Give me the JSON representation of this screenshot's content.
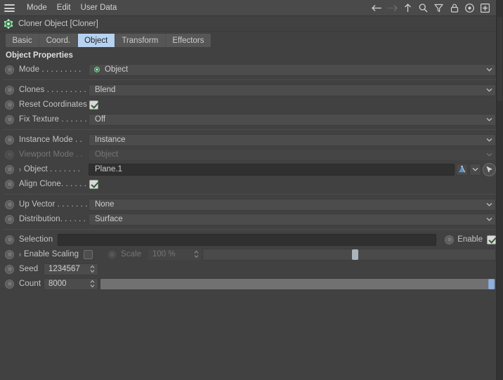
{
  "window": {
    "title": "Cloner Object [Cloner]",
    "title_icon": "cloner-object-icon"
  },
  "menubar": {
    "hamburger_icon": "hamburger-menu-icon",
    "items": [
      {
        "label": "Mode"
      },
      {
        "label": "Edit"
      },
      {
        "label": "User Data"
      }
    ],
    "tool_icons": [
      {
        "name": "back-arrow-icon",
        "state": "enabled"
      },
      {
        "name": "forward-arrow-icon",
        "state": "disabled"
      },
      {
        "name": "up-arrow-icon",
        "state": "enabled"
      },
      {
        "name": "search-icon",
        "state": "enabled"
      },
      {
        "name": "filter-funnel-icon",
        "state": "enabled"
      },
      {
        "name": "lock-icon",
        "state": "enabled"
      },
      {
        "name": "target-circle-icon",
        "state": "enabled"
      },
      {
        "name": "add-panel-icon",
        "state": "enabled"
      }
    ]
  },
  "tabs": [
    {
      "label": "Basic",
      "active": false
    },
    {
      "label": "Coord.",
      "active": false
    },
    {
      "label": "Object",
      "active": true
    },
    {
      "label": "Transform",
      "active": false
    },
    {
      "label": "Effectors",
      "active": false
    }
  ],
  "section": {
    "title": "Object Properties"
  },
  "fields": {
    "mode": {
      "label": "Mode . . . . . . . . .",
      "value": "Object",
      "icon": "cloner-mode-icon"
    },
    "clones": {
      "label": "Clones . . . . . . . . .",
      "value": "Blend"
    },
    "reset_coordinates": {
      "label": "Reset Coordinates",
      "checked": true
    },
    "fix_texture": {
      "label": "Fix Texture . . . . . .",
      "value": "Off"
    },
    "instance_mode": {
      "label": "Instance Mode . .",
      "value": "Instance"
    },
    "viewport_mode": {
      "label": "Viewport Mode . .",
      "value": "Object",
      "disabled": true
    },
    "object": {
      "label": "Object . . . . . . .",
      "value": "Plane.1",
      "expander": "›"
    },
    "align_clone": {
      "label": "Align Clone. . . . . .",
      "checked": true
    },
    "up_vector": {
      "label": "Up Vector . . . . . . .",
      "value": "None"
    },
    "distribution": {
      "label": "Distribution. . . . . .",
      "value": "Surface"
    },
    "selection": {
      "label": "Selection",
      "value": "",
      "enable_label": "Enable",
      "enable_checked": true
    },
    "enable_scaling": {
      "label": "Enable Scaling",
      "checked": false,
      "expander": "›"
    },
    "scale": {
      "label": "Scale",
      "value": "100 %",
      "disabled": true,
      "slider_percent": 51
    },
    "seed": {
      "label": "Seed",
      "value": "1234567"
    },
    "count": {
      "label": "Count",
      "value": "8000",
      "slider_percent": 96
    }
  },
  "colors": {
    "panel_bg": "#414141",
    "menubar_bg": "#4a4a4a",
    "accent_tab": "#b7d2f0",
    "slider_handle": "#8db1de",
    "field_bg": "#4c4c4c",
    "dark_field_bg": "#303030"
  }
}
